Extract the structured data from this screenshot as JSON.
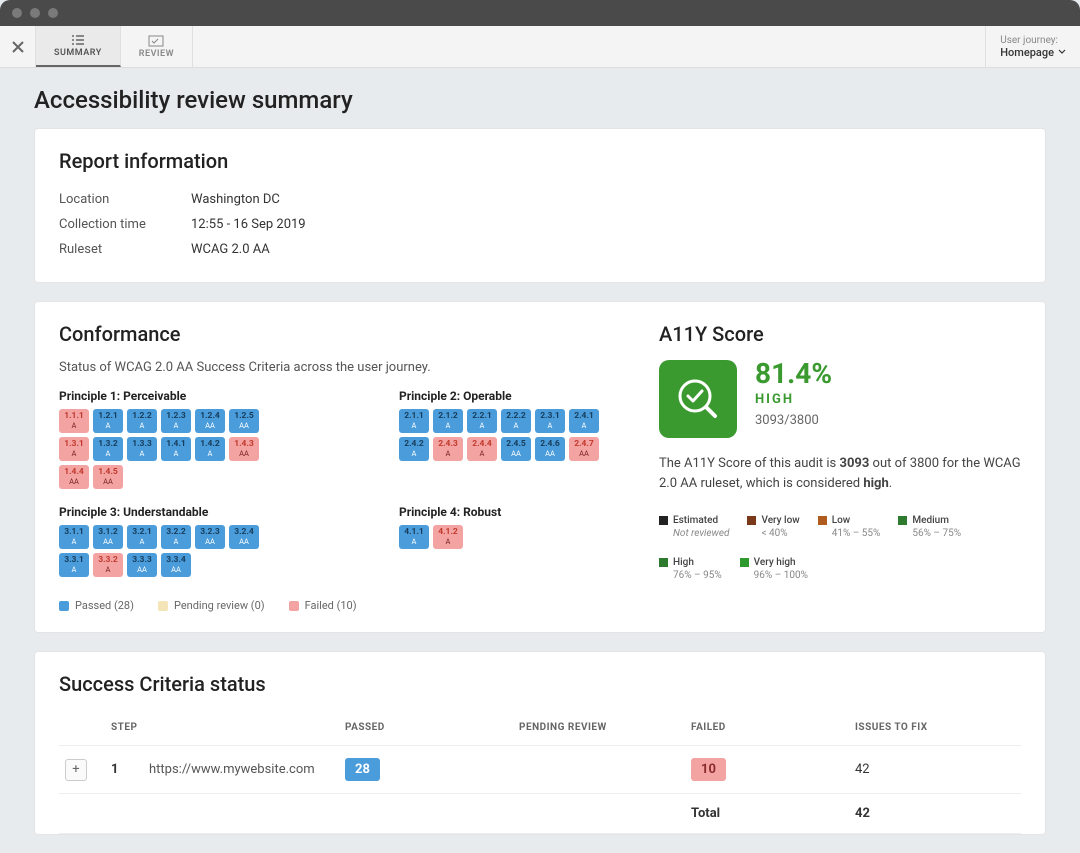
{
  "tabs": {
    "summary": "SUMMARY",
    "review": "REVIEW"
  },
  "journey": {
    "label": "User journey:",
    "value": "Homepage"
  },
  "page_title": "Accessibility review summary",
  "report_info": {
    "heading": "Report information",
    "location_label": "Location",
    "location_value": "Washington DC",
    "time_label": "Collection time",
    "time_value": "12:55 - 16 Sep 2019",
    "ruleset_label": "Ruleset",
    "ruleset_value": "WCAG 2.0 AA"
  },
  "conformance": {
    "heading": "Conformance",
    "subtext": "Status of WCAG 2.0 AA Success Criteria across the user journey.",
    "principles": {
      "p1": "Principle 1: Perceivable",
      "p2": "Principle 2: Operable",
      "p3": "Principle 3: Understandable",
      "p4": "Principle 4: Robust"
    },
    "legend": {
      "passed": "Passed (28)",
      "pending": "Pending review (0)",
      "failed": "Failed (10)"
    },
    "p1_criteria": [
      {
        "code": "1.1.1",
        "level": "A",
        "status": "failed"
      },
      {
        "code": "1.2.1",
        "level": "A",
        "status": "passed"
      },
      {
        "code": "1.2.2",
        "level": "A",
        "status": "passed"
      },
      {
        "code": "1.2.3",
        "level": "A",
        "status": "passed"
      },
      {
        "code": "1.2.4",
        "level": "AA",
        "status": "passed"
      },
      {
        "code": "1.2.5",
        "level": "AA",
        "status": "passed"
      },
      {
        "code": "1.3.1",
        "level": "A",
        "status": "failed"
      },
      {
        "code": "1.3.2",
        "level": "A",
        "status": "passed"
      },
      {
        "code": "1.3.3",
        "level": "A",
        "status": "passed"
      },
      {
        "code": "1.4.1",
        "level": "A",
        "status": "passed"
      },
      {
        "code": "1.4.2",
        "level": "A",
        "status": "passed"
      },
      {
        "code": "1.4.3",
        "level": "AA",
        "status": "failed"
      },
      {
        "code": "1.4.4",
        "level": "AA",
        "status": "failed"
      },
      {
        "code": "1.4.5",
        "level": "AA",
        "status": "failed"
      }
    ],
    "p2_criteria": [
      {
        "code": "2.1.1",
        "level": "A",
        "status": "passed"
      },
      {
        "code": "2.1.2",
        "level": "A",
        "status": "passed"
      },
      {
        "code": "2.2.1",
        "level": "A",
        "status": "passed"
      },
      {
        "code": "2.2.2",
        "level": "A",
        "status": "passed"
      },
      {
        "code": "2.3.1",
        "level": "A",
        "status": "passed"
      },
      {
        "code": "2.4.1",
        "level": "A",
        "status": "passed"
      },
      {
        "code": "2.4.2",
        "level": "A",
        "status": "passed"
      },
      {
        "code": "2.4.3",
        "level": "A",
        "status": "failed"
      },
      {
        "code": "2.4.4",
        "level": "A",
        "status": "failed"
      },
      {
        "code": "2.4.5",
        "level": "AA",
        "status": "passed"
      },
      {
        "code": "2.4.6",
        "level": "AA",
        "status": "passed"
      },
      {
        "code": "2.4.7",
        "level": "AA",
        "status": "failed"
      }
    ],
    "p3_criteria": [
      {
        "code": "3.1.1",
        "level": "A",
        "status": "passed"
      },
      {
        "code": "3.1.2",
        "level": "AA",
        "status": "passed"
      },
      {
        "code": "3.2.1",
        "level": "A",
        "status": "passed"
      },
      {
        "code": "3.2.2",
        "level": "A",
        "status": "passed"
      },
      {
        "code": "3.2.3",
        "level": "AA",
        "status": "passed"
      },
      {
        "code": "3.2.4",
        "level": "AA",
        "status": "passed"
      },
      {
        "code": "3.3.1",
        "level": "A",
        "status": "passed"
      },
      {
        "code": "3.3.2",
        "level": "A",
        "status": "failed"
      },
      {
        "code": "3.3.3",
        "level": "AA",
        "status": "passed"
      },
      {
        "code": "3.3.4",
        "level": "AA",
        "status": "passed"
      }
    ],
    "p4_criteria": [
      {
        "code": "4.1.1",
        "level": "A",
        "status": "passed"
      },
      {
        "code": "4.1.2",
        "level": "A",
        "status": "failed"
      }
    ]
  },
  "score": {
    "heading": "A11Y Score",
    "percent": "81.4%",
    "rating": "HIGH",
    "fraction": "3093/3800",
    "desc_prefix": "The A11Y Score of this audit is ",
    "desc_score": "3093",
    "desc_middle": " out of 3800 for the WCAG 2.0 AA ruleset, which is considered ",
    "desc_rating": "high",
    "desc_suffix": ".",
    "legend": [
      {
        "color": "#222",
        "label": "Estimated",
        "sub": "Not reviewed",
        "italic": true
      },
      {
        "color": "#7a3a1a",
        "label": "Very low",
        "sub": "< 40%"
      },
      {
        "color": "#b05c1e",
        "label": "Low",
        "sub": "41% – 55%"
      },
      {
        "color": "#2e7a2e",
        "label": "Medium",
        "sub": "56% – 75%"
      },
      {
        "color": "#2e7a2e",
        "label": "High",
        "sub": "76% – 95%"
      },
      {
        "color": "#2e9a2e",
        "label": "Very high",
        "sub": "96% – 100%"
      }
    ]
  },
  "status_table": {
    "heading": "Success Criteria status",
    "headers": {
      "step": "STEP",
      "passed": "PASSED",
      "pending": "PENDING REVIEW",
      "failed": "FAILED",
      "issues": "ISSUES TO FIX"
    },
    "rows": [
      {
        "num": "1",
        "url": "https://www.mywebsite.com",
        "passed": "28",
        "pending": "",
        "failed": "10",
        "issues": "42"
      }
    ],
    "total_label": "Total",
    "total_issues": "42"
  }
}
